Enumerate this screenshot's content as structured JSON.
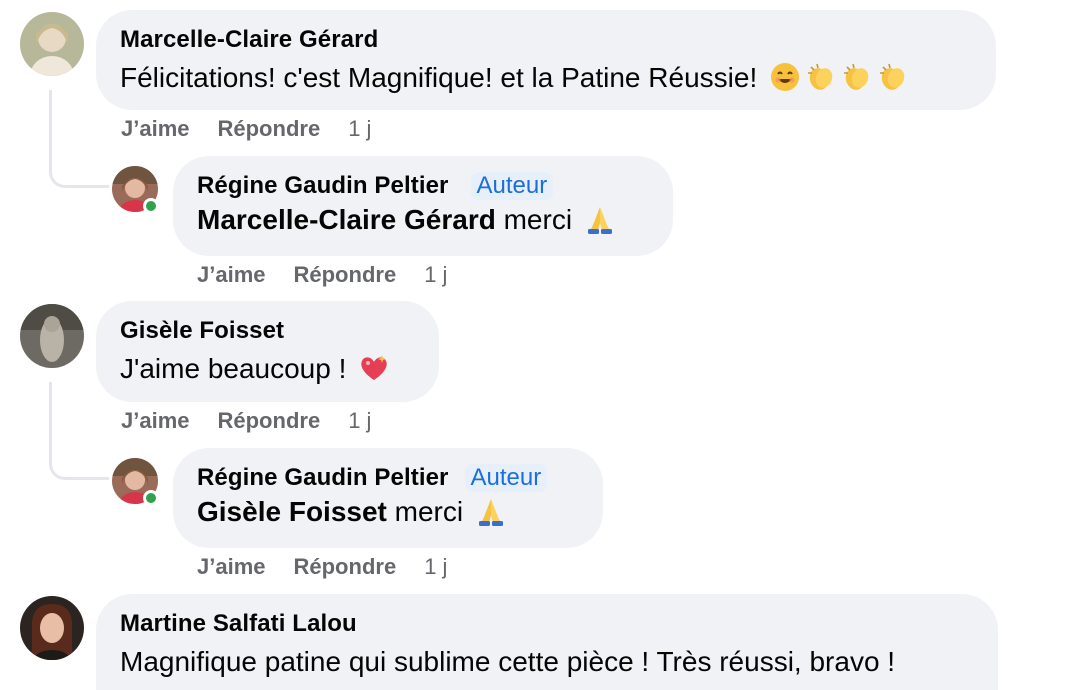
{
  "comments": [
    {
      "author": "Marcelle-Claire Gérard",
      "text": "Félicitations! c'est Magnifique! et la Patine Réussie!",
      "emojis": [
        "smiling-face-icon",
        "clapping-hands-icon",
        "clapping-hands-icon",
        "clapping-hands-icon"
      ],
      "like_label": "J’aime",
      "reply_label": "Répondre",
      "time": "1 j",
      "reply": {
        "author": "Régine Gaudin Peltier",
        "badge": "Auteur",
        "mention": "Marcelle-Claire Gérard",
        "text": " merci",
        "emoji": "folded-hands-icon",
        "like_label": "J’aime",
        "reply_label": "Répondre",
        "time": "1 j"
      }
    },
    {
      "author": "Gisèle Foisset",
      "text": "J'aime beaucoup !",
      "emojis": [
        "sparkling-heart-icon"
      ],
      "like_label": "J’aime",
      "reply_label": "Répondre",
      "time": "1 j",
      "reply": {
        "author": "Régine Gaudin Peltier",
        "badge": "Auteur",
        "mention": "Gisèle Foisset",
        "text": " merci",
        "emoji": "folded-hands-icon",
        "like_label": "J’aime",
        "reply_label": "Répondre",
        "time": "1 j"
      }
    },
    {
      "author": "Martine Salfati Lalou",
      "text": "Magnifique patine qui sublime cette pièce ! Très réussi, bravo !"
    }
  ],
  "colors": {
    "bubble": "#f0f2f5",
    "badge_text": "#1b6fd8",
    "meta_text": "#65676b",
    "online": "#31a24c"
  }
}
